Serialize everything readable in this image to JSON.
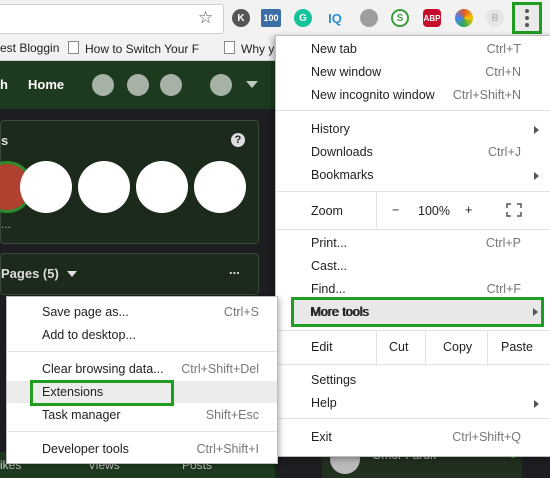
{
  "bookmarks": [
    {
      "label": "est Bloggin"
    },
    {
      "label": "How to Switch Your F"
    },
    {
      "label": "Why y"
    }
  ],
  "extensions": [
    {
      "label": "K",
      "color": "#555555"
    },
    {
      "label": "100",
      "color": "#3b6ea5"
    },
    {
      "label": "G",
      "color": "#15c39a"
    },
    {
      "label": "IQ",
      "color": "#2b8fd8"
    },
    {
      "label": "",
      "color": "#9e9e9e"
    },
    {
      "label": "S",
      "color": "#3a9d3a"
    },
    {
      "label": "ABP",
      "color": "#c70d2c"
    },
    {
      "label": "",
      "color": "#e05a2a"
    },
    {
      "label": "B",
      "color": "#cfcfcf"
    }
  ],
  "facebook": {
    "nav_left": "h",
    "home": "Home",
    "stories_title": "s",
    "pages_title": "Pages (5)",
    "more": "...",
    "bottom_tabs": [
      "ikes",
      "Views",
      "Posts"
    ],
    "chat_name": "Omor Faruk"
  },
  "chrome_menu": {
    "new_tab": {
      "label": "New tab",
      "shortcut": "Ctrl+T"
    },
    "new_window": {
      "label": "New window",
      "shortcut": "Ctrl+N"
    },
    "incognito": {
      "label": "New incognito window",
      "shortcut": "Ctrl+Shift+N"
    },
    "history": {
      "label": "History"
    },
    "downloads": {
      "label": "Downloads",
      "shortcut": "Ctrl+J"
    },
    "bookmarks": {
      "label": "Bookmarks"
    },
    "zoom": {
      "label": "Zoom",
      "minus": "−",
      "value": "100%",
      "plus": "+"
    },
    "print": {
      "label": "Print...",
      "shortcut": "Ctrl+P"
    },
    "cast": {
      "label": "Cast..."
    },
    "find": {
      "label": "Find...",
      "shortcut": "Ctrl+F"
    },
    "more_tools": {
      "label": "More tools"
    },
    "edit": {
      "label": "Edit",
      "cut": "Cut",
      "copy": "Copy",
      "paste": "Paste"
    },
    "settings": {
      "label": "Settings"
    },
    "help": {
      "label": "Help"
    },
    "exit": {
      "label": "Exit",
      "shortcut": "Ctrl+Shift+Q"
    }
  },
  "more_tools_menu": {
    "save_page": {
      "label": "Save page as...",
      "shortcut": "Ctrl+S"
    },
    "add_desktop": {
      "label": "Add to desktop..."
    },
    "clear_data": {
      "label": "Clear browsing data...",
      "shortcut": "Ctrl+Shift+Del"
    },
    "extensions": {
      "label": "Extensions"
    },
    "task_manager": {
      "label": "Task manager",
      "shortcut": "Shift+Esc"
    },
    "dev_tools": {
      "label": "Developer tools",
      "shortcut": "Ctrl+Shift+I"
    }
  },
  "highlight_color": "#1f9d1f"
}
